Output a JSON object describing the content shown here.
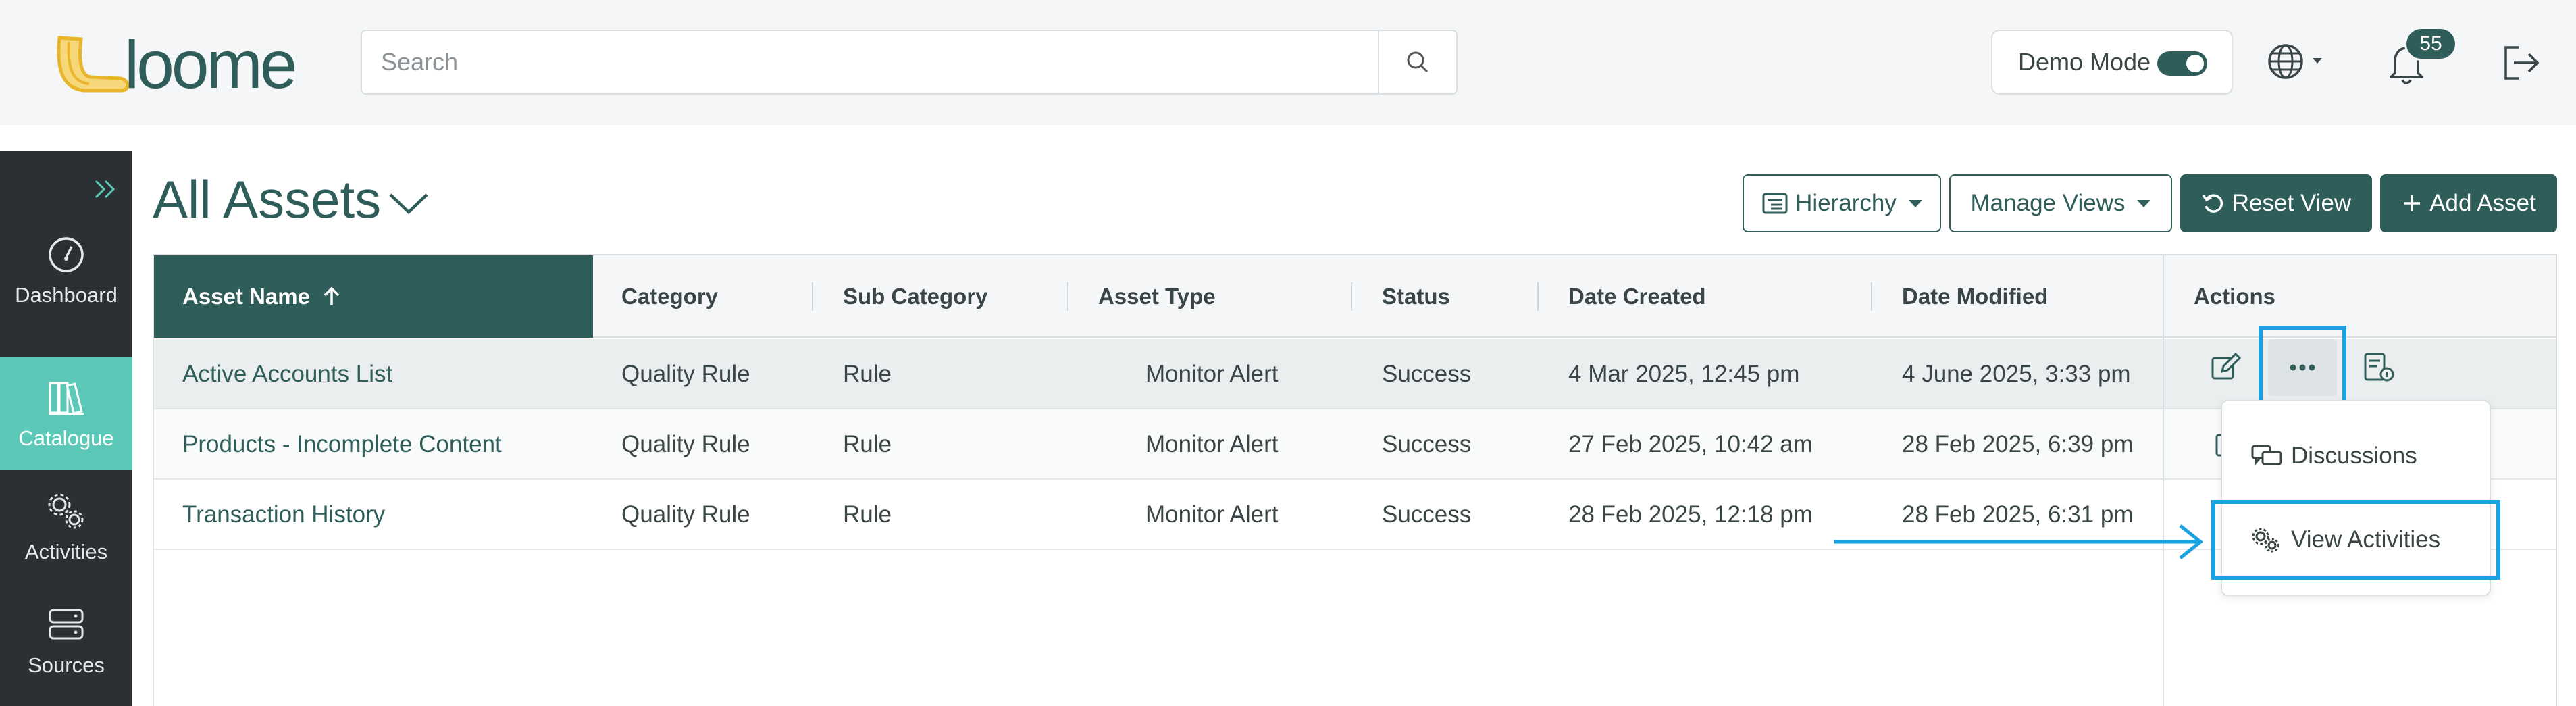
{
  "app": {
    "brand": "Loome",
    "colors": {
      "primary": "#2f5d5a",
      "accent": "#5cc8b8",
      "sidebar_bg": "#2b3034",
      "highlight": "#1aa3e0",
      "logo_yellow": "#f2c230"
    }
  },
  "header": {
    "search_placeholder": "Search",
    "search_icon": "search-icon",
    "demo_mode_label": "Demo Mode",
    "demo_mode_on": true,
    "language_icon": "globe-icon",
    "notification_count": "55",
    "logout_icon": "logout-icon"
  },
  "sidebar": {
    "expand_icon": "double-chevron-right-icon",
    "items": [
      {
        "label": "Dashboard",
        "icon": "gauge-icon",
        "active": false
      },
      {
        "label": "Catalogue",
        "icon": "books-icon",
        "active": true
      },
      {
        "label": "Activities",
        "icon": "gears-icon",
        "active": false
      },
      {
        "label": "Sources",
        "icon": "server-icon",
        "active": false
      }
    ]
  },
  "page": {
    "title": "All Assets",
    "buttons": {
      "hierarchy": "Hierarchy",
      "manage_views": "Manage Views",
      "reset_view": "Reset View",
      "add_asset": "Add Asset"
    }
  },
  "table": {
    "columns": [
      "Asset Name",
      "Category",
      "Sub Category",
      "Asset Type",
      "Status",
      "Date Created",
      "Date Modified",
      "Actions"
    ],
    "sorted_column": "Asset Name",
    "sort_direction": "ascending",
    "rows": [
      {
        "name": "Active Accounts List",
        "category": "Quality Rule",
        "sub_category": "Rule",
        "asset_type": "Monitor Alert",
        "status": "Success",
        "created": "4 Mar 2025, 12:45 pm",
        "modified": "4 June 2025, 3:33 pm"
      },
      {
        "name": "Products - Incomplete Content",
        "category": "Quality Rule",
        "sub_category": "Rule",
        "asset_type": "Monitor Alert",
        "status": "Success",
        "created": "27 Feb 2025, 10:42 am",
        "modified": "28 Feb 2025, 6:39 pm"
      },
      {
        "name": "Transaction History",
        "category": "Quality Rule",
        "sub_category": "Rule",
        "asset_type": "Monitor Alert",
        "status": "Success",
        "created": "28 Feb 2025, 12:18 pm",
        "modified": "28 Feb 2025, 6:31 pm"
      }
    ],
    "row_actions": [
      "edit-icon",
      "tag-icon",
      "details-icon",
      "more-icon"
    ]
  },
  "dropdown_menu": {
    "items": [
      {
        "label": "Discussions",
        "icon": "chat-icon"
      },
      {
        "label": "View Activities",
        "icon": "gears-icon"
      }
    ]
  }
}
